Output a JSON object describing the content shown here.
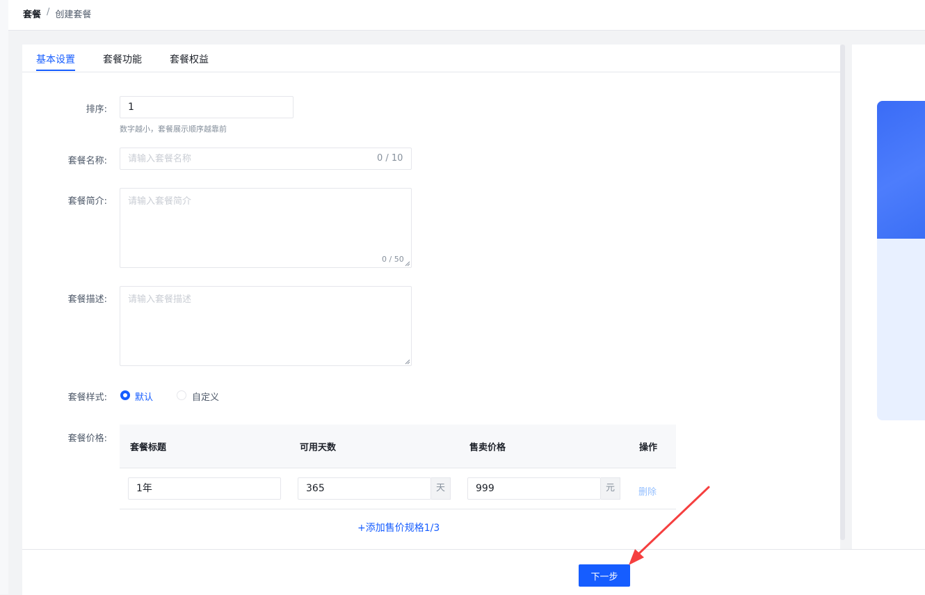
{
  "breadcrumb": {
    "root": "套餐",
    "separator": "/",
    "current": "创建套餐"
  },
  "tabs": [
    {
      "label": "基本设置",
      "active": true
    },
    {
      "label": "套餐功能",
      "active": false
    },
    {
      "label": "套餐权益",
      "active": false
    }
  ],
  "form": {
    "sort": {
      "label": "排序:",
      "value": "1",
      "hint": "数字越小，套餐展示顺序越靠前"
    },
    "name": {
      "label": "套餐名称:",
      "placeholder": "请输入套餐名称",
      "counter": "0 / 10"
    },
    "intro": {
      "label": "套餐简介:",
      "placeholder": "请输入套餐简介",
      "counter": "0 / 50"
    },
    "desc": {
      "label": "套餐描述:",
      "placeholder": "请输入套餐描述"
    },
    "style": {
      "label": "套餐样式:",
      "options": [
        {
          "label": "默认",
          "checked": true
        },
        {
          "label": "自定义",
          "checked": false
        }
      ]
    },
    "price": {
      "label": "套餐价格:",
      "columns": [
        "套餐标题",
        "可用天数",
        "售卖价格",
        "操作"
      ],
      "rows": [
        {
          "title": "1年",
          "days": "365",
          "days_unit": "天",
          "price": "999",
          "price_unit": "元",
          "action": "删除"
        }
      ],
      "add_label": "+添加售价规格1/3"
    }
  },
  "footer": {
    "next_label": "下一步"
  },
  "colors": {
    "primary": "#165dff",
    "annotation_arrow": "#f53f3f",
    "preview_blue": "#3a6cf6"
  }
}
